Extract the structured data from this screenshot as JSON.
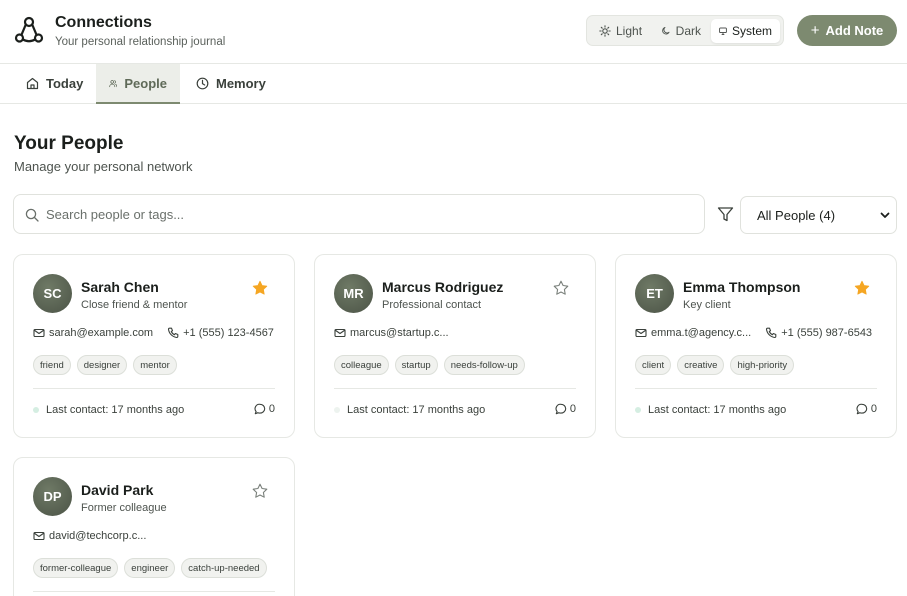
{
  "app": {
    "title": "Connections",
    "subtitle": "Your personal relationship journal"
  },
  "theme": {
    "light": "Light",
    "dark": "Dark",
    "system": "System",
    "selected": "System"
  },
  "add_note": "Add Note",
  "tabs": [
    {
      "label": "Today",
      "icon": "home-icon"
    },
    {
      "label": "People",
      "icon": "users-icon",
      "active": true
    },
    {
      "label": "Memory",
      "icon": "clock-icon"
    }
  ],
  "main": {
    "title": "Your People",
    "subtitle": "Manage your personal network"
  },
  "search": {
    "placeholder": "Search people or tags...",
    "value": ""
  },
  "filter": {
    "selected": "All People (4)"
  },
  "colors": {
    "accent": "#7d8a70",
    "star": "#f5a623",
    "avatar": "#5a6352"
  },
  "people": [
    {
      "initials": "SC",
      "name": "Sarah Chen",
      "role": "Close friend & mentor",
      "favorite": true,
      "email": "sarah@example.com",
      "phone": "+1 (555) 123-4567",
      "tags": [
        "friend",
        "designer",
        "mentor"
      ],
      "last_contact": "Last contact: 17 months ago",
      "notes": "0"
    },
    {
      "initials": "MR",
      "name": "Marcus Rodriguez",
      "role": "Professional contact",
      "favorite": false,
      "email": "marcus@startup.c...",
      "phone": "",
      "tags": [
        "colleague",
        "startup",
        "needs-follow-up"
      ],
      "last_contact": "Last contact: 17 months ago",
      "notes": "0"
    },
    {
      "initials": "ET",
      "name": "Emma Thompson",
      "role": "Key client",
      "favorite": true,
      "email": "emma.t@agency.c...",
      "phone": "+1 (555) 987-6543",
      "tags": [
        "client",
        "creative",
        "high-priority"
      ],
      "last_contact": "Last contact: 17 months ago",
      "notes": "0"
    },
    {
      "initials": "DP",
      "name": "David Park",
      "role": "Former colleague",
      "favorite": false,
      "email": "david@techcorp.c...",
      "phone": "",
      "tags": [
        "former-colleague",
        "engineer",
        "catch-up-needed"
      ],
      "last_contact": "",
      "notes": ""
    }
  ]
}
